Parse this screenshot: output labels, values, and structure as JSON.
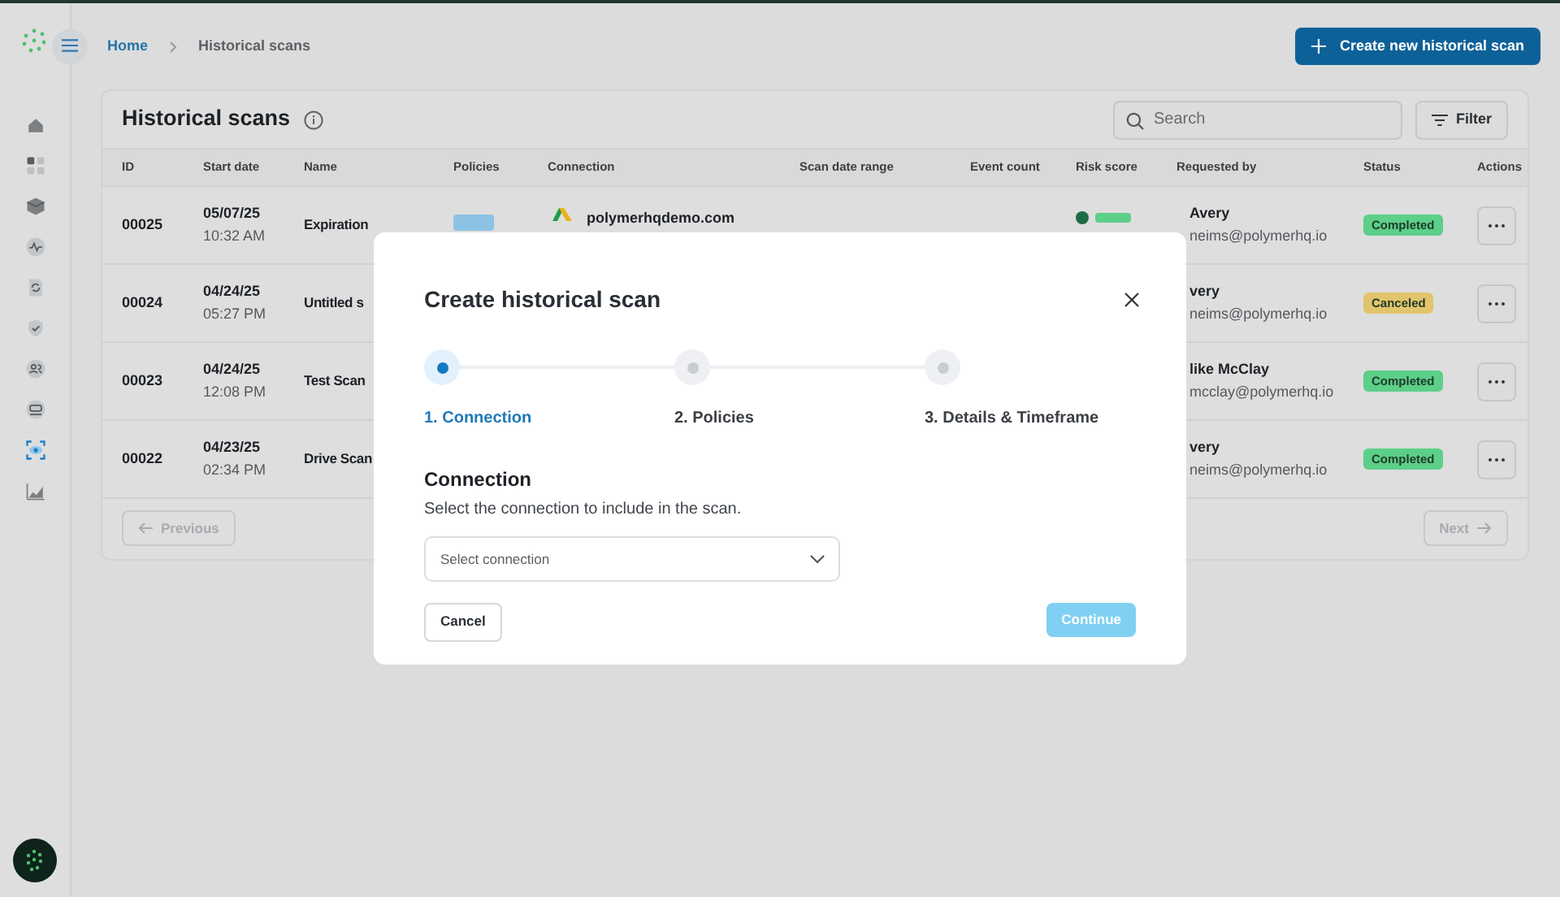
{
  "nav_items": [
    {
      "selected": false
    },
    {
      "selected": false
    },
    {
      "selected": false
    },
    {
      "selected": false
    },
    {
      "selected": false
    },
    {
      "selected": false
    },
    {
      "selected": false
    },
    {
      "selected": false
    },
    {
      "selected": true
    },
    {
      "selected": false
    }
  ],
  "breadcrumbs": [
    "Home",
    "Historical scans"
  ],
  "create_button": "Create new historical scan",
  "card": {
    "title": "Historical scans",
    "search": {
      "placeholder": "Search"
    },
    "filter_button": "Filter"
  },
  "table": {
    "columns": [
      "ID",
      "Start date",
      "Name",
      "Policies",
      "Connection",
      "Scan date range",
      "Event count",
      "Risk score",
      "Requested by",
      "Status",
      "Actions"
    ],
    "rows": [
      {
        "id": "00025",
        "date": "05/07/25",
        "time": "10:32 AM",
        "name": "Expiration",
        "connection": "polymerhqdemo.com",
        "requester": "Avery",
        "email": "neims@polymerhq.io",
        "status": {
          "label": "Completed",
          "color": "#5ccf88"
        }
      },
      {
        "id": "00024",
        "date": "04/24/25",
        "time": "05:27 PM",
        "name": "Untitled s",
        "requester": "very",
        "email": "neims@polymerhq.io",
        "status": {
          "label": "Canceled",
          "color": "#e2c46c"
        }
      },
      {
        "id": "00023",
        "date": "04/24/25",
        "time": "12:08 PM",
        "name": "Test Scan",
        "requester": "like McClay",
        "email": "mcclay@polymerhq.io",
        "status": {
          "label": "Completed",
          "color": "#5ccf88"
        }
      },
      {
        "id": "00022",
        "date": "04/23/25",
        "time": "02:34 PM",
        "name": "Drive Scan",
        "requester": "very",
        "email": "neims@polymerhq.io",
        "status": {
          "label": "Completed",
          "color": "#5ccf88"
        }
      }
    ]
  },
  "pagination": {
    "previous": "Previous",
    "next": "Next",
    "previous_disabled": true,
    "next_disabled": true
  },
  "modal": {
    "title": "Create historical scan",
    "steps": [
      {
        "label": "1. Connection",
        "selected": true
      },
      {
        "label": "2. Policies",
        "selected": false
      },
      {
        "label": "3. Details & Timeframe",
        "selected": false
      }
    ],
    "heading": "Connection",
    "description": "Select the connection to include in the scan.",
    "select": {
      "placeholder": "Select connection"
    },
    "cancel": "Cancel",
    "continue": {
      "label": "Continue",
      "disabled": true
    }
  }
}
